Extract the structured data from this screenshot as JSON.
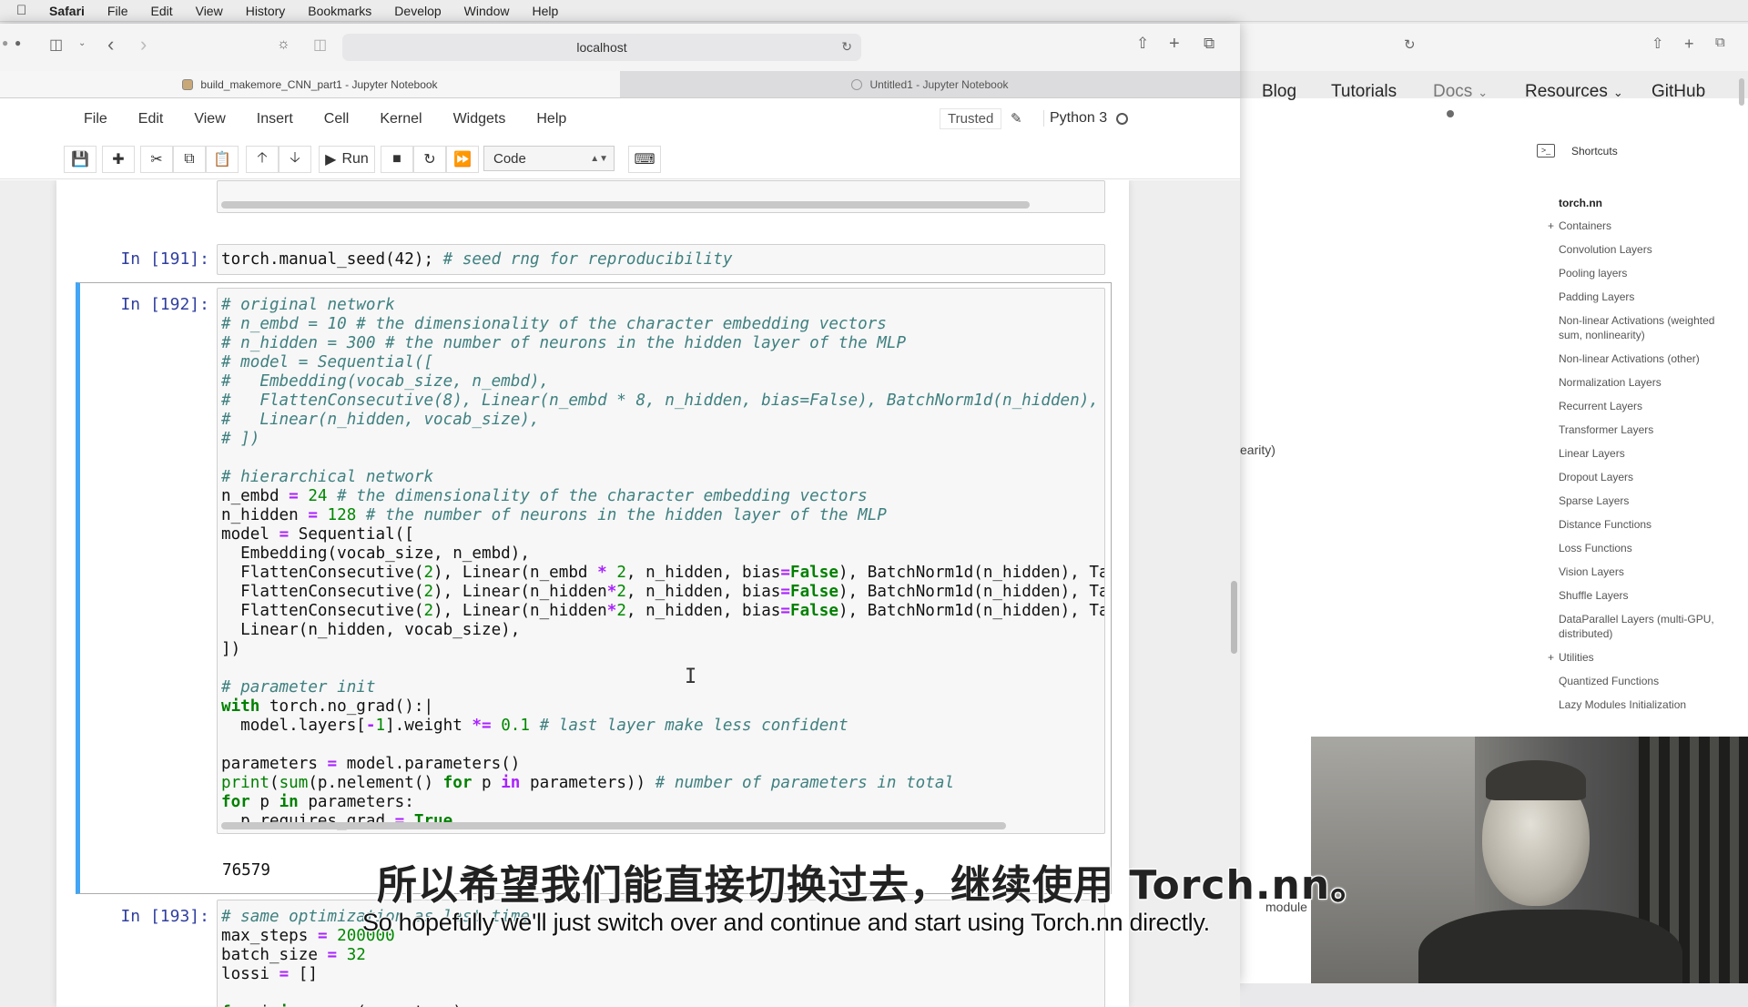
{
  "mac_menubar": {
    "apple": "",
    "items": [
      "Safari",
      "File",
      "Edit",
      "View",
      "History",
      "Bookmarks",
      "Develop",
      "Window",
      "Help"
    ]
  },
  "safari": {
    "url": "localhost",
    "tabs": [
      {
        "title": "build_makemore_CNN_part1 - Jupyter Notebook"
      },
      {
        "title": "Untitled1 - Jupyter Notebook"
      }
    ]
  },
  "jupyter": {
    "menu": [
      "File",
      "Edit",
      "View",
      "Insert",
      "Cell",
      "Kernel",
      "Widgets",
      "Help"
    ],
    "trusted": "Trusted",
    "kernel": "Python 3",
    "toolbar": {
      "run_label": "Run",
      "cell_type": "Code"
    },
    "cells": [
      {
        "prompt": "In [191]:",
        "code_seed": "torch.manual_seed(42);",
        "comment_seed": "# seed rng for reproducibility"
      },
      {
        "prompt": "In [192]:",
        "output": "76579"
      },
      {
        "prompt": "In [193]:"
      }
    ]
  },
  "docs": {
    "nav": [
      "Blog",
      "Tutorials",
      "Docs",
      "Resources",
      "GitHub"
    ],
    "shortcuts": "Shortcuts",
    "section_head": "torch.nn",
    "items": [
      "Containers",
      "Convolution Layers",
      "Pooling layers",
      "Padding Layers",
      "Non-linear Activations (weighted sum, nonlinearity)",
      "Non-linear Activations (other)",
      "Normalization Layers",
      "Recurrent Layers",
      "Transformer Layers",
      "Linear Layers",
      "Dropout Layers",
      "Sparse Layers",
      "Distance Functions",
      "Loss Functions",
      "Vision Layers",
      "Shuffle Layers",
      "DataParallel Layers (multi-GPU, distributed)",
      "Utilities",
      "Quantized Functions",
      "Lazy Modules Initialization"
    ],
    "partial_text": "earity)"
  },
  "subtitles": {
    "chinese": "所以希望我们能直接切换过去，继续使用 Torch.nn。",
    "english": "So hopefully we'll just switch over and continue and start using Torch.nn directly."
  },
  "ghost_text": "module",
  "colors": {
    "cell_selected_border": "#66bb6a",
    "prompt": "#303f9f",
    "comment": "#408080",
    "keyword": "#008000"
  }
}
